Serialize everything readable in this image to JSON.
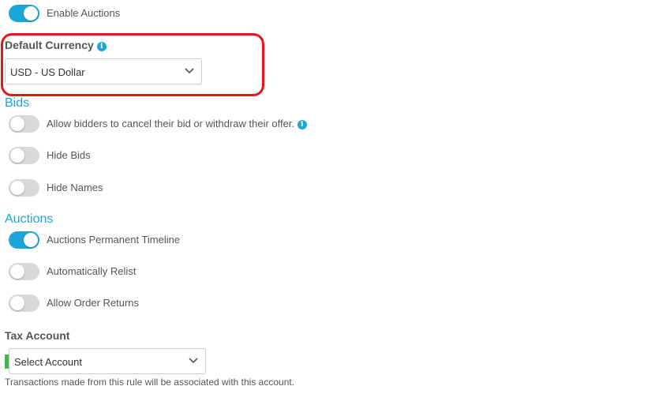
{
  "enable_auctions": {
    "label": "Enable Auctions",
    "on": true
  },
  "default_currency": {
    "label": "Default Currency",
    "info_icon": "info-icon",
    "selected": "USD - US Dollar"
  },
  "bids": {
    "heading": "Bids",
    "options": [
      {
        "label": "Allow bidders to cancel their bid or withdraw their offer.",
        "on": false,
        "has_info": true
      },
      {
        "label": "Hide Bids",
        "on": false
      },
      {
        "label": "Hide Names",
        "on": false
      }
    ]
  },
  "auctions": {
    "heading": "Auctions",
    "options": [
      {
        "label": "Auctions Permanent Timeline",
        "on": true
      },
      {
        "label": "Automatically Relist",
        "on": false
      },
      {
        "label": "Allow Order Returns",
        "on": false
      }
    ]
  },
  "tax_account": {
    "label": "Tax Account",
    "selected": "Select Account",
    "help": "Transactions made from this rule will be associated with this account."
  },
  "colors": {
    "accent": "#1ba6d9",
    "toggle_off": "#d9d9d9",
    "highlight": "#e8141a",
    "marker": "#4caf50"
  }
}
